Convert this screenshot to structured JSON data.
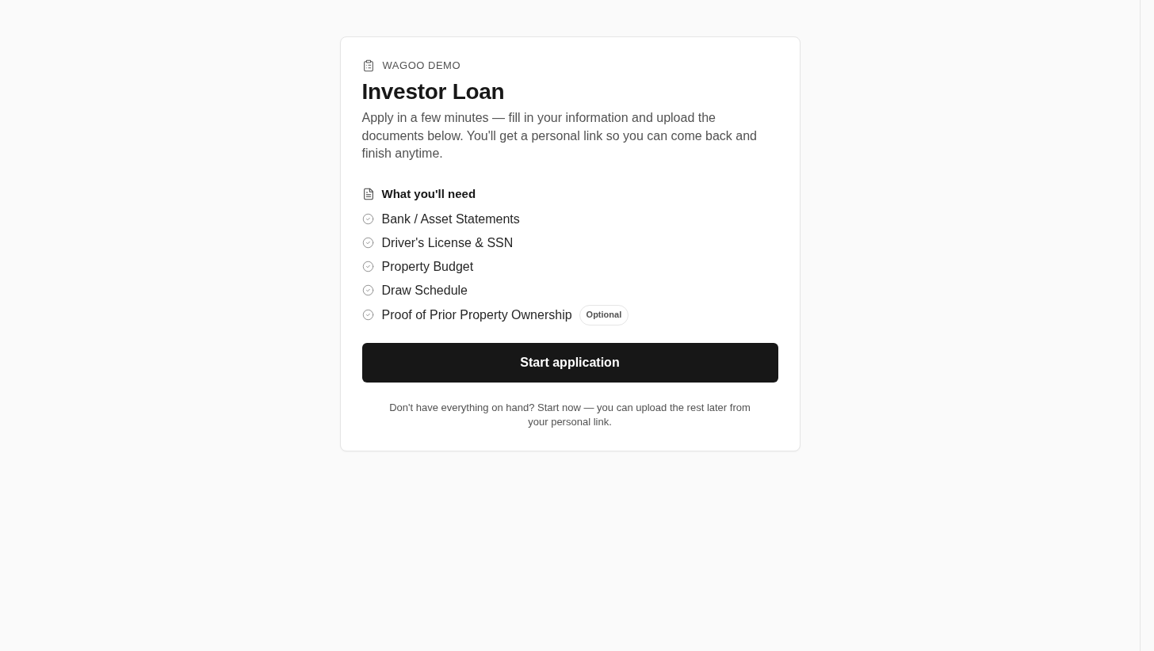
{
  "card": {
    "brand": "WAGOO DEMO",
    "title": "Investor Loan",
    "description": "Apply in a few minutes — fill in your information and upload the documents below. You'll get a personal link so you can come back and finish anytime.",
    "requirements": {
      "heading": "What you'll need",
      "items": [
        {
          "label": "Bank / Asset Statements"
        },
        {
          "label": "Driver's License & SSN"
        },
        {
          "label": "Property Budget"
        },
        {
          "label": "Draw Schedule"
        },
        {
          "label": "Proof of Prior Property Ownership",
          "badge": "Optional"
        }
      ]
    },
    "primary_button": "Start application",
    "footnote": "Don't have everything on hand? Start now — you can upload the rest later from your personal link."
  }
}
